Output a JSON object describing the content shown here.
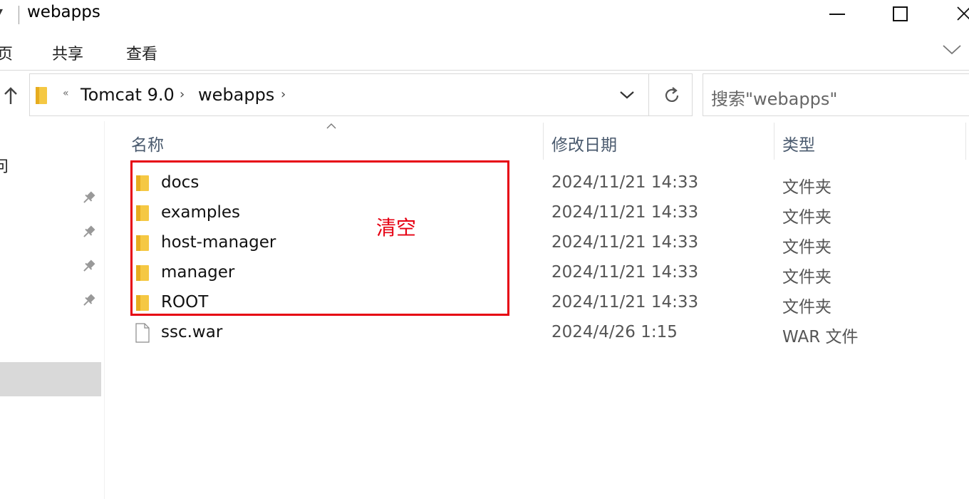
{
  "window": {
    "title": "webapps",
    "title_icon": "chevron-down-icon",
    "controls": [
      "minimize-icon",
      "maximize-icon",
      "close-icon"
    ]
  },
  "ribbon": {
    "tabs": [
      "页",
      "共享",
      "查看"
    ],
    "expand_icon": "chevron-down-icon"
  },
  "address": {
    "overflow": "«",
    "crumbs": [
      "Tomcat 9.0",
      "webapps"
    ],
    "crumb_separator": "›"
  },
  "search": {
    "placeholder": "搜索\"webapps\""
  },
  "nav": {
    "visible_fragments": [
      "问",
      ","
    ],
    "pinned_icon": "pin-icon"
  },
  "columns": [
    "名称",
    "修改日期",
    "类型"
  ],
  "files": [
    {
      "name": "docs",
      "modified": "2024/11/21 14:33",
      "type": "文件夹",
      "icon": "folder-icon"
    },
    {
      "name": "examples",
      "modified": "2024/11/21 14:33",
      "type": "文件夹",
      "icon": "folder-icon"
    },
    {
      "name": "host-manager",
      "modified": "2024/11/21 14:33",
      "type": "文件夹",
      "icon": "folder-icon"
    },
    {
      "name": "manager",
      "modified": "2024/11/21 14:33",
      "type": "文件夹",
      "icon": "folder-icon"
    },
    {
      "name": "ROOT",
      "modified": "2024/11/21 14:33",
      "type": "文件夹",
      "icon": "folder-icon"
    },
    {
      "name": "ssc.war",
      "modified": "2024/4/26 1:15",
      "type": "WAR 文件",
      "icon": "file-icon"
    }
  ],
  "annotation": {
    "text": "清空",
    "color": "#e60012"
  },
  "colors": {
    "folder": "#f5c843",
    "annotation": "#e60012",
    "header_text": "#4a5a6e"
  }
}
